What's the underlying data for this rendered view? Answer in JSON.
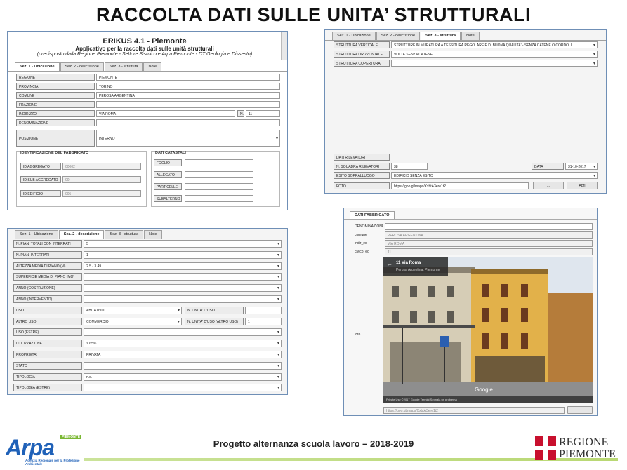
{
  "slide_title": "RACCOLTA DATI SULLE UNITA’ STRUTTURALI",
  "panel1": {
    "app_title": "ERIKUS 4.1 - Piemonte",
    "app_subtitle": "Applicativo per la raccolta dati sulle unità strutturali",
    "app_note": "(predisposto dalla Regione Piemonte - Settore Sismico e Arpa Piemonte - DT Geologia e Dissesto)",
    "tabs": [
      "Sez. 1 - Ubicazione",
      "Sez. 2 - descrizione",
      "Sez. 3 - struttura",
      "Note"
    ],
    "regione_label": "REGIONE",
    "regione_value": "PIEMONTE",
    "provincia_label": "PROVINCIA",
    "provincia_value": "TORINO",
    "comune_label": "COMUNE",
    "comune_value": "PEROSA ARGENTINA",
    "frazione_label": "FRAZIONE",
    "indirizzo_label": "INDIRIZZO",
    "indirizzo_value": "VIA ROMA",
    "numero_label": "N.",
    "numero_value": "11",
    "denominazione_label": "DENOMINAZIONE",
    "posizione_label": "POSIZIONE",
    "posizione_value": "INTERNO",
    "identificazione_title": "IDENTIFICAZIONE DEL FABBRICATO",
    "id_aggregato_label": "ID AGGREGATO",
    "id_aggregato_value": "00002",
    "id_sub_label": "ID SUB AGGREGATO",
    "id_sub_value": "00",
    "id_edificio_label": "ID EDIFICIO",
    "id_edificio_value": "005",
    "catastali_title": "DATI CATASTALI",
    "foglio_label": "FOGLIO",
    "allegato_label": "ALLEGATO",
    "particelle_label": "PARTICELLE",
    "subalterno_label": "SUBALTERNO"
  },
  "panel2": {
    "tabs": [
      "Sez. 1 - Ubicazione",
      "Sez. 2 - descrizione",
      "Sez. 3 - struttura",
      "Note"
    ],
    "rows": [
      {
        "label": "STRUTTURA VERTICALE",
        "value": "STRUTTURE IN MURATURA A TESSITURA REGOLARE E DI BUONA QUALITA' - SENZA CATENE O CORDOLI"
      },
      {
        "label": "STRUTTURA ORIZZONTALE",
        "value": "VOLTE SENZA CATENE"
      },
      {
        "label": "STRUTTURA COPERTURA",
        "value": ""
      }
    ],
    "rilevatori_label": "DATI RILEVATORI",
    "squadra_label": "N. SQUADRA RILEVATORI",
    "squadra_value": "38",
    "data_label": "DATA",
    "data_value": "31-10-2017",
    "esito_label": "ESITO SOPRALLUOGO",
    "esito_value": "EDIFICIO SENZA ESITO",
    "foto_label": "FOTO",
    "foto_value": "https://goo.gl/maps/XxbtA3ere1t2",
    "browse_label": "...",
    "open_label": "Apri"
  },
  "panel3": {
    "tabs": [
      "Sez. 1 - Ubicazione",
      "Sez. 2 - descrizione",
      "Sez. 3 - struttura",
      "Note"
    ],
    "rows": [
      {
        "label": "N. PIANI TOTALI CON INTERRATI",
        "value": "5"
      },
      {
        "label": "N. PIANI INTERRATI",
        "value": "1"
      },
      {
        "label": "ALTEZZA MEDIA DI PIANO (m)",
        "value": "2.5 - 3.49"
      },
      {
        "label": "SUPERFICIE MEDIA DI PIANO (mq)",
        "value": ""
      },
      {
        "label": "ANNO (COSTRUZIONE)",
        "value": ""
      },
      {
        "label": "ANNO (INTERVENTO)",
        "value": ""
      },
      {
        "label": "USO",
        "value": "ABITATIVO",
        "side_label": "N. UNITA' D'USO",
        "side_value": "1"
      },
      {
        "label": "ALTRO USO",
        "value": "COMMERCIO",
        "side_label": "N. UNITA' D'USO (ALTRO USO)",
        "side_value": "1"
      },
      {
        "label": "USO (ESTRE)",
        "value": ""
      },
      {
        "label": "UTILIZZAZIONE",
        "value": "> 65%"
      },
      {
        "label": "PROPRIETA'",
        "value": "PRIVATA"
      },
      {
        "label": "STATO",
        "value": ""
      },
      {
        "label": "TIPOLOGIA",
        "value": "n.d."
      },
      {
        "label": "TIPOLOGIA (ESTRE)",
        "value": ""
      }
    ]
  },
  "panel4": {
    "header": "DATI FABBRICATO",
    "denominazione_label": "DENOMINAZIONE",
    "comune_label": "comune",
    "comune_value": "PEROSA ARGENTINA",
    "indir_label": "indir_ed",
    "indir_value": "VIA ROMA",
    "civico_label": "civico_ed",
    "civico_value": "11",
    "foto_label": "foto",
    "sv_address": "11 Via Roma",
    "sv_locality": "Perosa Argentina, Piemonte",
    "sv_watermark": "Google",
    "sv_footer": "Private Use   ©2017 Google   Termini   Segnala un problema",
    "foto_url": "https://goo.gl/maps/XxbtA3ere1t2"
  },
  "footer": {
    "project_text": "Progetto alternanza scuola lavoro – 2018-2019",
    "arpa_logo_text": "Arpa",
    "arpa_badge": "PIEMONTE",
    "arpa_caption": "Agenzia Regionale per la Protezione Ambientale",
    "regione_line1": "REGIONE",
    "regione_line2": "PIEMONTE"
  }
}
